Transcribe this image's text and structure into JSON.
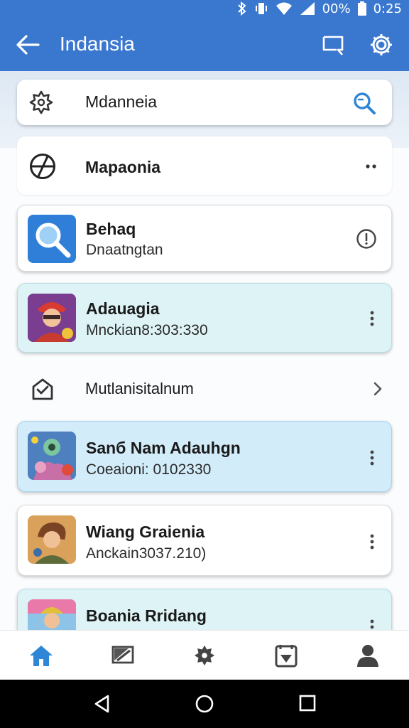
{
  "status_bar": {
    "battery_text": "00%",
    "time": "0:25"
  },
  "app_bar": {
    "title": "Indansia"
  },
  "search": {
    "value": "Mdanneia"
  },
  "menu_row": {
    "label": "Mapaonia"
  },
  "items": [
    {
      "title": "Behaq",
      "subtitle": "Dnaatngtan"
    },
    {
      "title": "Adauagia",
      "subtitle": "Mnckian8:303:330"
    },
    {
      "title": "Mutlanisitalnum"
    },
    {
      "title": "Sanб Nam Adauhgn",
      "subtitle": "Coeaioni: 0102330"
    },
    {
      "title": "Wiang Graienia",
      "subtitle": "Anckain3037.210)"
    },
    {
      "title": "Boania Rridang"
    }
  ],
  "colors": {
    "app_bar": "#3a77cf",
    "accent": "#2f86d6",
    "nav_active": "#2f86d6"
  },
  "icons": {
    "bottom_nav": [
      "home-icon",
      "messages-icon",
      "badge-icon",
      "gallery-icon",
      "profile-icon"
    ],
    "system_nav": [
      "back-triangle-icon",
      "home-circle-icon",
      "recents-square-icon"
    ]
  }
}
